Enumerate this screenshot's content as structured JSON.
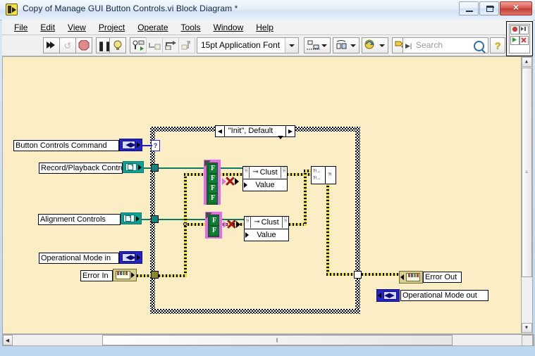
{
  "window": {
    "title": "Copy of Manage GUI Button Controls.vi Block Diagram *",
    "app_icon": "labview-vi-icon",
    "minimize_label": "–",
    "maximize_label": "□",
    "close_label": "✕"
  },
  "menu": {
    "items": [
      {
        "label": "File"
      },
      {
        "label": "Edit"
      },
      {
        "label": "View"
      },
      {
        "label": "Project"
      },
      {
        "label": "Operate"
      },
      {
        "label": "Tools"
      },
      {
        "label": "Window"
      },
      {
        "label": "Help"
      }
    ]
  },
  "toolbar": {
    "buttons": [
      {
        "name": "run-button",
        "glyph": "➤"
      },
      {
        "name": "run-continuously-button",
        "glyph": "↻"
      },
      {
        "name": "abort-execution-button",
        "glyph": "⬣"
      },
      {
        "name": "pause-button",
        "glyph": "❙❙"
      },
      {
        "name": "highlight-execution-button",
        "glyph": "◎"
      },
      {
        "name": "retain-wire-values-button",
        "glyph": "⚙"
      },
      {
        "name": "step-into-button",
        "glyph": "↵"
      },
      {
        "name": "step-over-button",
        "glyph": "↷"
      },
      {
        "name": "step-out-button",
        "glyph": "↱"
      }
    ],
    "font_selector": {
      "value": "15pt Application Font",
      "name": "font-selector"
    },
    "align_objects": {
      "name": "align-objects-button"
    },
    "distribute_objects": {
      "name": "distribute-objects-button"
    },
    "reorder": {
      "name": "reorder-button"
    },
    "clean_up_diagram": {
      "name": "clean-up-diagram-button"
    },
    "search": {
      "placeholder": "Search",
      "value": "",
      "name": "search-input"
    },
    "help_label": "?"
  },
  "diagram": {
    "case_structure": {
      "selector_text": "\"Init\", Default",
      "left_arrow": "◀",
      "right_arrow": "▶",
      "selector_terminal_glyph": "?"
    },
    "input_terminals": [
      {
        "label": "Button Controls Command",
        "type": "enum",
        "glyph": "◀▶"
      },
      {
        "label": "Record/Playback Controls",
        "type": "cluster",
        "glyph": "cluster-icon"
      },
      {
        "label": "Alignment Controls",
        "type": "cluster",
        "glyph": "cluster-icon"
      },
      {
        "label": "Operational Mode in",
        "type": "enum",
        "glyph": "◀▶"
      },
      {
        "label": "Error In",
        "type": "error-cluster",
        "glyph": "error-icon"
      }
    ],
    "output_terminals": [
      {
        "label": "Error Out",
        "type": "error-cluster",
        "glyph": "error-icon"
      },
      {
        "label": "Operational Mode out",
        "type": "enum",
        "glyph": "◀▶"
      }
    ],
    "boolean_array_constants": [
      {
        "name": "boolean-array-4",
        "values": [
          "F",
          "F",
          "F",
          "F"
        ]
      },
      {
        "name": "boolean-array-2",
        "values": [
          "F",
          "F"
        ]
      }
    ],
    "bundle_nodes": [
      {
        "name": "bundle-by-name-1",
        "top_label": "Clust",
        "bottom_label": "Value"
      },
      {
        "name": "bundle-by-name-2",
        "top_label": "Clust",
        "bottom_label": "Value"
      }
    ],
    "merge_node": {
      "name": "bundle-node",
      "glyph": "?!"
    }
  },
  "scrollbars": {
    "v_up": "▲",
    "v_down": "▼",
    "h_left": "◀",
    "h_right": "▶",
    "grip": "‖"
  },
  "colors": {
    "canvas": "#fbeec4",
    "error_wire": "#e8e02a",
    "cluster_wire": "#0a7a5e",
    "enum_terminal": "#2323c8",
    "cluster_terminal": "#12a094",
    "boolean_green": "#0f7d32",
    "array_pink": "#e96ae9"
  }
}
